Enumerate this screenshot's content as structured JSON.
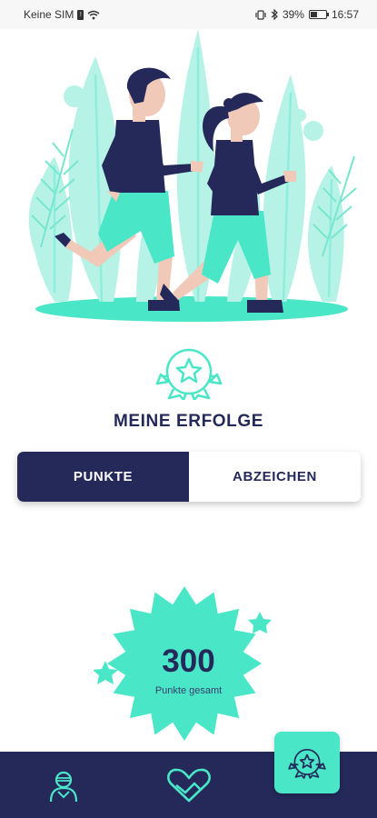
{
  "status_bar": {
    "carrier": "Keine SIM",
    "battery": "39%",
    "battery_fraction": 0.39,
    "time": "16:57"
  },
  "hero": {
    "illustration_icon": "two-joggers-illustration"
  },
  "header": {
    "icon": "award-medal-icon",
    "title": "MEINE ERFOLGE"
  },
  "toggle": {
    "points_label": "PUNKTE",
    "badges_label": "ABZEICHEN",
    "active": "points"
  },
  "points": {
    "value": "300",
    "label": "Punkte gesamt"
  },
  "bottom_nav": {
    "items": [
      {
        "icon": "profile-icon",
        "active": false
      },
      {
        "icon": "heart-health-icon",
        "active": false
      },
      {
        "icon": "achievements-medal-icon",
        "active": true
      }
    ]
  },
  "colors": {
    "primary": "#24295a",
    "accent": "#49e6c8",
    "accent_light": "#b6f3e6"
  }
}
